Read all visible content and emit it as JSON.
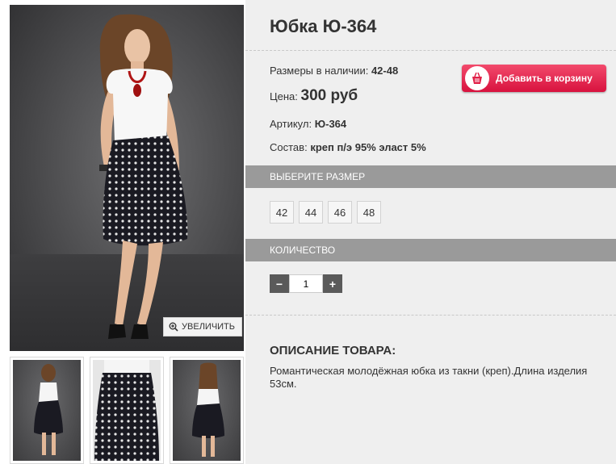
{
  "product": {
    "title": "Юбка Ю-364",
    "sizes_label": "Размеры в наличии:",
    "sizes_value": "42-48",
    "price_label": "Цена:",
    "price_value": "300 руб",
    "article_label": "Артикул:",
    "article_value": "Ю-364",
    "composition_label": "Состав:",
    "composition_value": "креп п/э 95% эласт 5%"
  },
  "cart_button": {
    "label": "Добавить в корзину",
    "icon": "basket-icon"
  },
  "gallery": {
    "zoom_label": "УВЕЛИЧИТЬ",
    "zoom_icon": "magnifier-plus-icon"
  },
  "size_section": {
    "header": "ВЫБЕРИТЕ РАЗМЕР",
    "options": [
      "42",
      "44",
      "46",
      "48"
    ]
  },
  "quantity_section": {
    "header": "КОЛИЧЕСТВО",
    "minus": "−",
    "plus": "+",
    "value": "1"
  },
  "description": {
    "title": "ОПИСАНИЕ ТОВАРА:",
    "text": "Романтическая молодёжная юбка из такни (креп).Длина изделия 53см."
  },
  "colors": {
    "accent": "#e01f47",
    "bar": "#9a9a9a",
    "panel": "#efefef"
  }
}
